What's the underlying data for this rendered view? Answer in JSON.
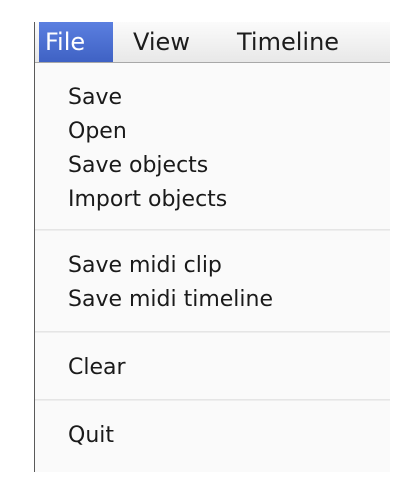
{
  "menubar": {
    "items": [
      {
        "label": "File",
        "active": true
      },
      {
        "label": "View",
        "active": false
      },
      {
        "label": "Timeline",
        "active": false
      }
    ]
  },
  "file_menu": {
    "groups": [
      [
        "Save",
        "Open",
        "Save objects",
        "Import objects"
      ],
      [
        "Save midi clip",
        "Save midi timeline"
      ],
      [
        "Clear"
      ],
      [
        "Quit"
      ]
    ]
  },
  "colors": {
    "active_menu_bg": "#4a6fd4",
    "active_menu_text": "#ffffff",
    "menu_text": "#1a1a1a"
  }
}
